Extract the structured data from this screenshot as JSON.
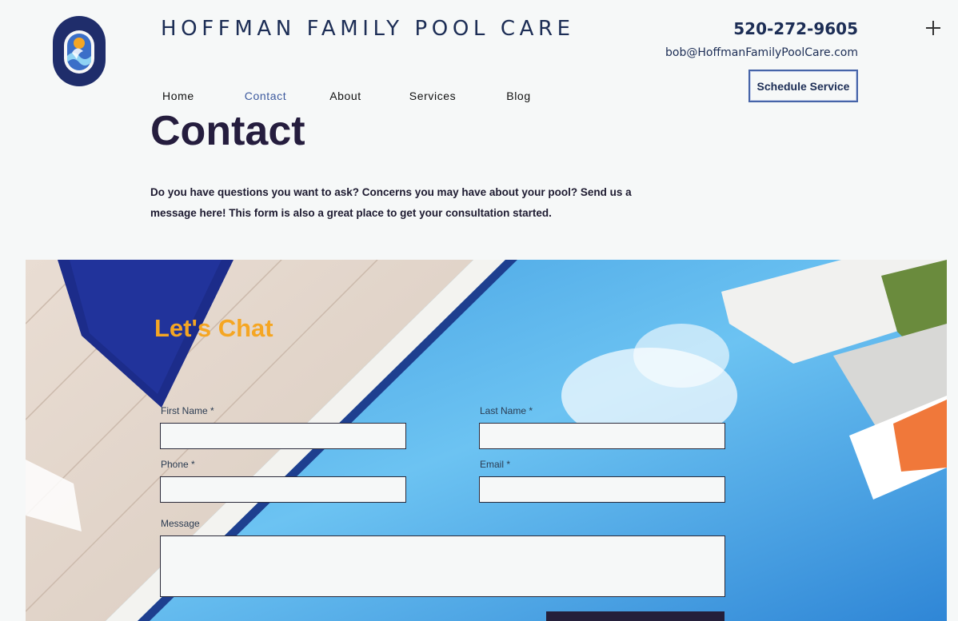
{
  "header": {
    "brand_name": "HOFFMAN FAMILY POOL CARE",
    "logo_text_top": "HOFFMAN FAMILY",
    "logo_text_bottom": "POOL CARE",
    "phone": "520-272-9605",
    "email": "bob@HoffmanFamilyPoolCare.com",
    "schedule_label": "Schedule Service",
    "menu_icon": "plus-icon"
  },
  "nav": {
    "items": [
      {
        "label": "Home"
      },
      {
        "label": "Contact"
      },
      {
        "label": "About"
      },
      {
        "label": "Services"
      },
      {
        "label": "Blog"
      }
    ],
    "active": "Contact"
  },
  "main": {
    "title": "Contact",
    "intro": "Do you have questions you want to ask? Concerns you may have about your pool? Send us a message here! This form is also a great place to get your consultation started."
  },
  "form": {
    "heading": "Let's Chat",
    "first_name_label": "First Name *",
    "last_name_label": "Last Name *",
    "phone_label": "Phone *",
    "email_label": "Email *",
    "message_label": "Message",
    "first_name_value": "",
    "last_name_value": "",
    "phone_value": "",
    "email_value": "",
    "message_value": ""
  },
  "colors": {
    "brand_navy": "#1c2d55",
    "accent_blue": "#3d5a9e",
    "chat_orange": "#f5a623",
    "page_bg": "#f6f8f8",
    "dark_title": "#251d3e"
  }
}
